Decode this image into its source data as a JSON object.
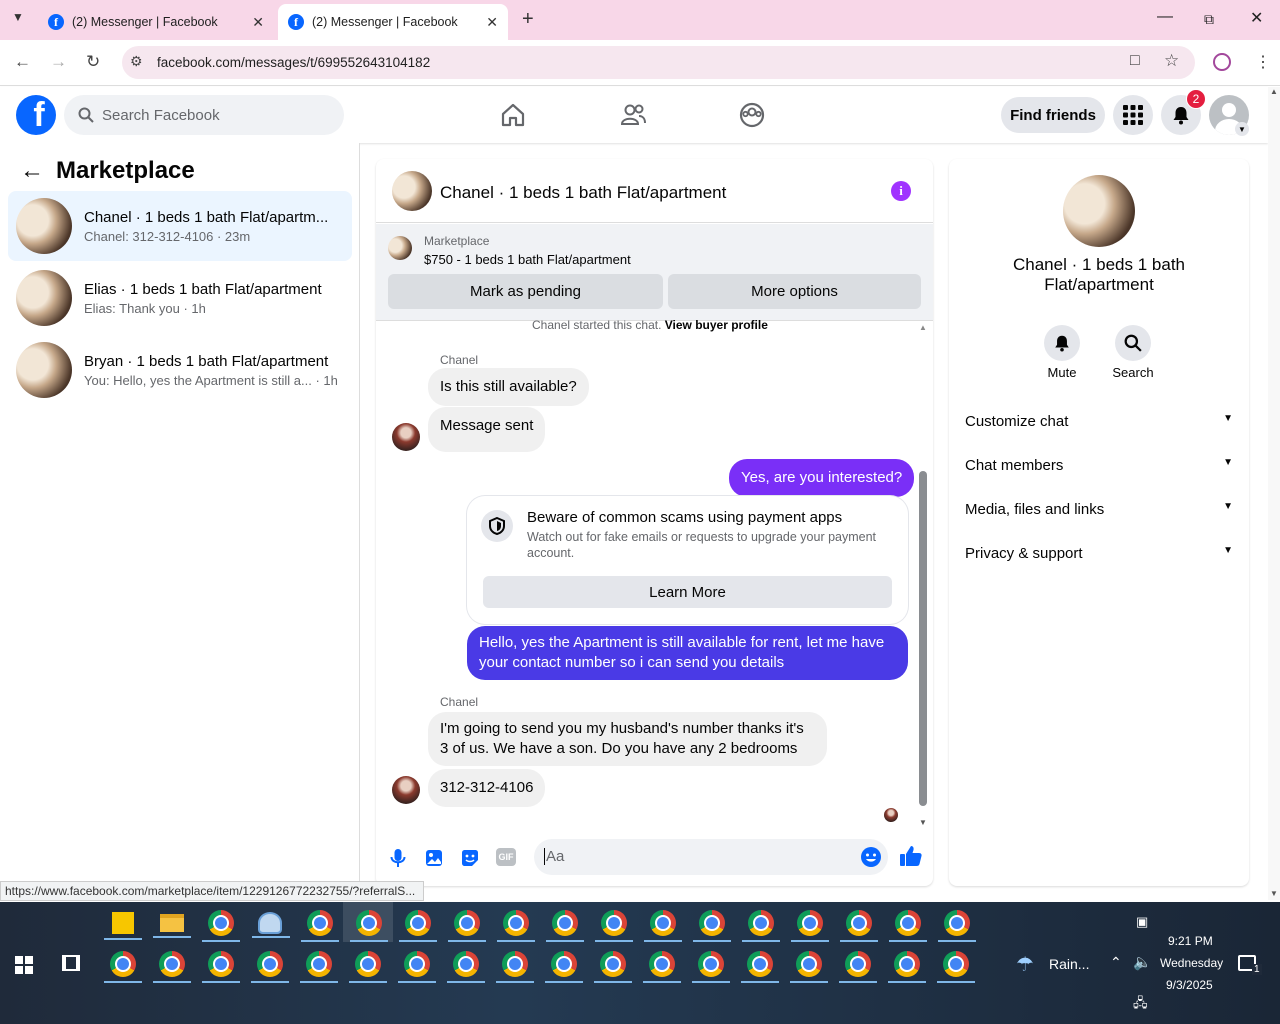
{
  "browser": {
    "tabs": [
      {
        "title": "(2) Messenger | Facebook",
        "active": false
      },
      {
        "title": "(2) Messenger | Facebook",
        "active": true
      }
    ],
    "url": "facebook.com/messages/t/699552643104182"
  },
  "header": {
    "search_placeholder": "Search Facebook",
    "find_friends": "Find friends",
    "notification_count": "2"
  },
  "sidebar": {
    "title": "Marketplace",
    "conversations": [
      {
        "name": "Chanel · 1 beds 1 bath Flat/apartm...",
        "preview": "Chanel: 312-312-4106 · 23m",
        "selected": true
      },
      {
        "name": "Elias · 1 beds 1 bath Flat/apartment",
        "preview": "Elias: Thank you · 1h",
        "selected": false
      },
      {
        "name": "Bryan · 1 beds 1 bath Flat/apartment",
        "preview": "You: Hello, yes the Apartment is still a... · 1h",
        "selected": false
      }
    ]
  },
  "chat": {
    "title": "Chanel · 1 beds 1 bath Flat/apartment",
    "marketplace_label": "Marketplace",
    "listing": "$750 - 1 beds 1 bath Flat/apartment",
    "mark_pending": "Mark as pending",
    "more_options": "More options",
    "started_text": "Chanel started this chat.",
    "view_profile": "View buyer profile",
    "sender_name": "Chanel",
    "msg1": "Is this still available?",
    "msg2": "Message sent",
    "msg3": "Yes, are you interested?",
    "scam_title": "Beware of common scams using payment apps",
    "scam_body": "Watch out for fake emails or requests to upgrade your payment account.",
    "learn_more": "Learn More",
    "msg4": "Hello, yes the Apartment is still available for rent, let me have your contact number so i can send you details",
    "sender_name2": "Chanel",
    "msg5": "I'm going to send you my husband's number thanks it's 3 of us. We have a son. Do you have any 2 bedrooms",
    "msg6": "312-312-4106",
    "composer_placeholder": "Aa",
    "gif_label": "GIF"
  },
  "details": {
    "name": "Chanel · 1 beds 1 bath Flat/apartment",
    "mute": "Mute",
    "search": "Search",
    "sections": [
      "Customize chat",
      "Chat members",
      "Media, files and links",
      "Privacy & support"
    ]
  },
  "status_url": "https://www.facebook.com/marketplace/item/1229126772232755/?referralS...",
  "taskbar": {
    "weather": "Rain...",
    "time": "9:21 PM",
    "day": "Wednesday",
    "date": "9/3/2025",
    "notif_count": "1"
  },
  "colors": {
    "fb_blue": "#0866ff",
    "outgoing": "#7a2ff7",
    "outgoing2": "#4a3ae6",
    "badge": "#e41e3f"
  }
}
